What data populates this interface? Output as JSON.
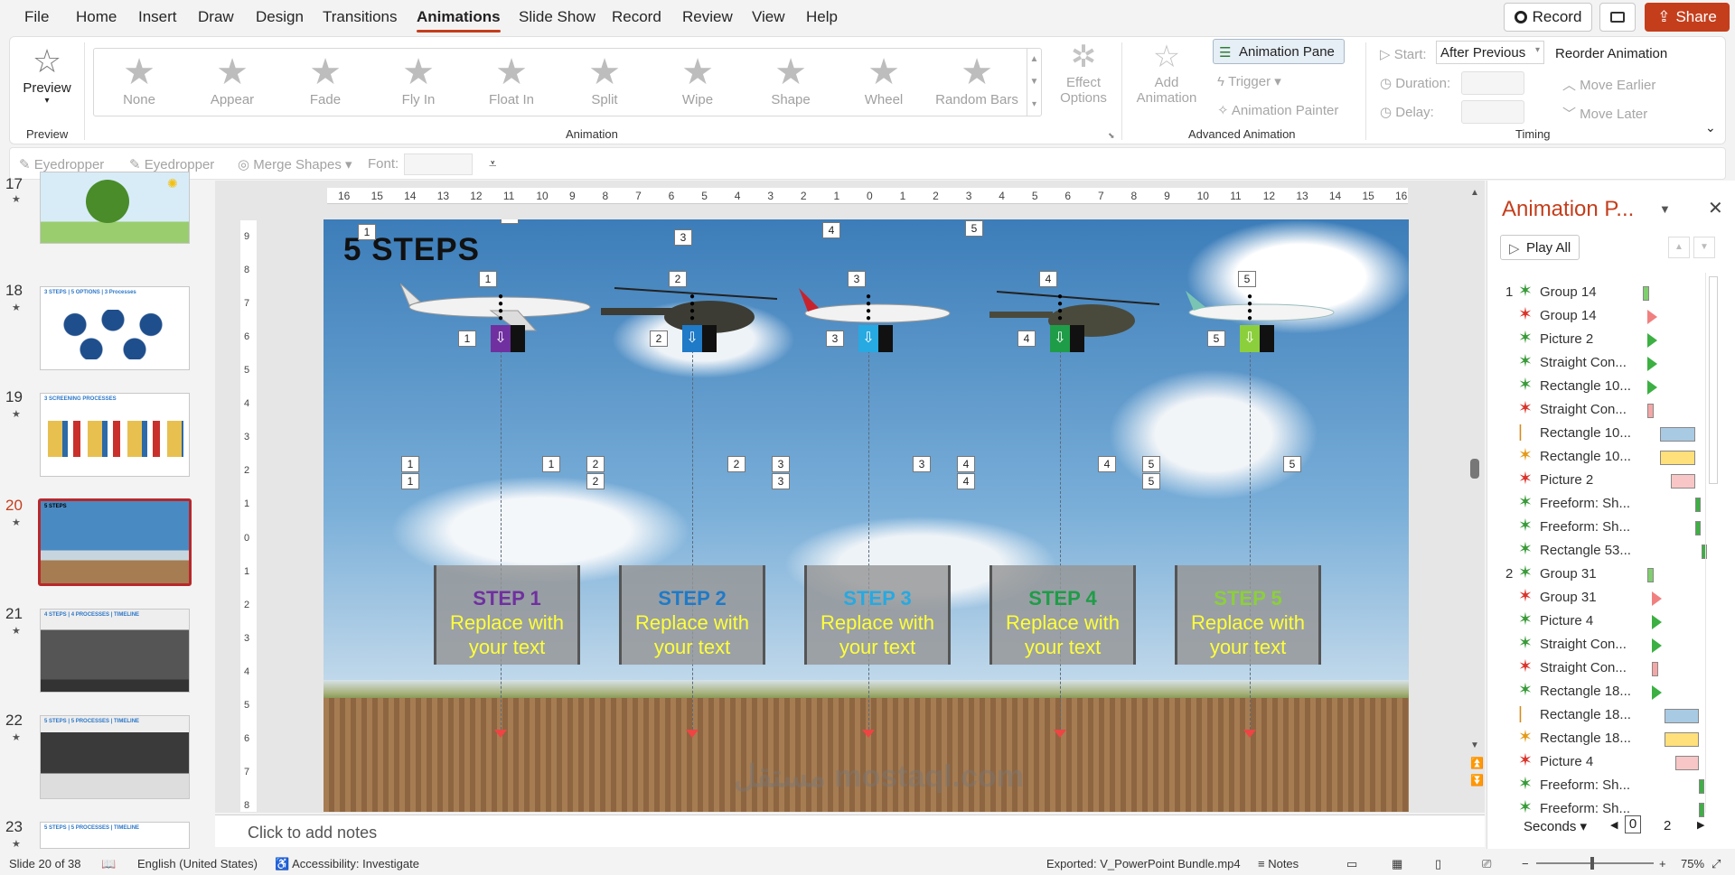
{
  "menu": {
    "items": [
      "File",
      "Home",
      "Insert",
      "Draw",
      "Design",
      "Transitions",
      "Animations",
      "Slide Show",
      "Record",
      "Review",
      "View",
      "Help"
    ],
    "active": "Animations",
    "record_label": "Record",
    "share_label": "Share"
  },
  "ribbon": {
    "preview_label": "Preview",
    "preview_group": "Preview",
    "animations": [
      "None",
      "Appear",
      "Fade",
      "Fly In",
      "Float In",
      "Split",
      "Wipe",
      "Shape",
      "Wheel",
      "Random Bars"
    ],
    "effect_options": "Effect Options",
    "animation_group": "Animation",
    "add_animation": "Add Animation",
    "animation_pane": "Animation Pane",
    "trigger": "Trigger",
    "animation_painter": "Animation Painter",
    "advanced_group": "Advanced Animation",
    "start_label": "Start:",
    "start_value": "After Previous",
    "duration_label": "Duration:",
    "delay_label": "Delay:",
    "timing_group": "Timing",
    "reorder_title": "Reorder Animation",
    "move_earlier": "Move Earlier",
    "move_later": "Move Later"
  },
  "qat": {
    "eyedropper1": "Eyedropper",
    "eyedropper2": "Eyedropper",
    "merge_shapes": "Merge Shapes",
    "font_label": "Font:"
  },
  "thumbnails": [
    {
      "num": "17",
      "title": ""
    },
    {
      "num": "18",
      "title": "3 STEPS | 5 OPTIONS | 3 Processes"
    },
    {
      "num": "19",
      "title": "3 SCREENING PROCESSES"
    },
    {
      "num": "20",
      "title": "5 STEPS"
    },
    {
      "num": "21",
      "title": "4 STEPS | 4 PROCESSES | TIMELINE"
    },
    {
      "num": "22",
      "title": "5 STEPS | 5 PROCESSES | TIMELINE"
    },
    {
      "num": "23",
      "title": "5 STEPS | 5 PROCESSES | TIMELINE"
    }
  ],
  "slide": {
    "title": "5 STEPS",
    "steps": [
      {
        "label": "STEP 1",
        "text1": "Replace with",
        "text2": "your text",
        "color": "#7030a0",
        "marker": "#7030a0"
      },
      {
        "label": "STEP 2",
        "text1": "Replace with",
        "text2": "your text",
        "color": "#1f7ac7",
        "marker": "#1f7ac7"
      },
      {
        "label": "STEP 3",
        "text1": "Replace with",
        "text2": "your text",
        "color": "#27a9e1",
        "marker": "#27a9e1"
      },
      {
        "label": "STEP 4",
        "text1": "Replace with",
        "text2": "your text",
        "color": "#1f9c47",
        "marker": "#1f9c47"
      },
      {
        "label": "STEP 5",
        "text1": "Replace with",
        "text2": "your text",
        "color": "#8ccf3c",
        "marker": "#8ccf3c"
      }
    ],
    "tags": [
      "1",
      "2",
      "3",
      "4",
      "5"
    ]
  },
  "ruler": {
    "h_ticks": [
      "16",
      "15",
      "14",
      "13",
      "12",
      "11",
      "10",
      "9",
      "8",
      "7",
      "6",
      "5",
      "4",
      "3",
      "2",
      "1",
      "0",
      "1",
      "2",
      "3",
      "4",
      "5",
      "6",
      "7",
      "8",
      "9",
      "10",
      "11",
      "12",
      "13",
      "14",
      "15",
      "16"
    ],
    "v_ticks": [
      "9",
      "8",
      "7",
      "6",
      "5",
      "4",
      "3",
      "2",
      "1",
      "0",
      "1",
      "2",
      "3",
      "4",
      "5",
      "6",
      "7",
      "8"
    ]
  },
  "notes": {
    "placeholder": "Click to add notes"
  },
  "pane": {
    "title": "Animation P...",
    "play_all": "Play All",
    "items": [
      {
        "num": "1",
        "label": "Group 14",
        "icon": "zoom",
        "color": "#3a9a3a",
        "bar": "#7fcf6e",
        "bar_type": "rect",
        "bar_pos": 0.55,
        "bar_w": 0.03
      },
      {
        "num": "",
        "label": "Group 14",
        "icon": "star",
        "color": "#d9342b",
        "bar": "#f08080",
        "bar_type": "tri",
        "bar_pos": 0.57,
        "bar_w": 0.03
      },
      {
        "num": "",
        "label": "Picture 2",
        "icon": "star",
        "color": "#3a9a3a",
        "bar": "#3cb043",
        "bar_type": "tri",
        "bar_pos": 0.57,
        "bar_w": 0.03
      },
      {
        "num": "",
        "label": "Straight Con...",
        "icon": "star",
        "color": "#3a9a3a",
        "bar": "#3cb043",
        "bar_type": "tri",
        "bar_pos": 0.57,
        "bar_w": 0.03
      },
      {
        "num": "",
        "label": "Rectangle 10...",
        "icon": "star",
        "color": "#3a9a3a",
        "bar": "#3cb043",
        "bar_type": "tri",
        "bar_pos": 0.57,
        "bar_w": 0.03
      },
      {
        "num": "",
        "label": "Straight Con...",
        "icon": "star",
        "color": "#d9342b",
        "bar": "#f5a6a6",
        "bar_type": "rect",
        "bar_pos": 0.57,
        "bar_w": 0.03
      },
      {
        "num": "",
        "label": "Rectangle 10...",
        "icon": "line",
        "color": "#d48a1a",
        "bar": "#a8cae3",
        "bar_type": "rect",
        "bar_pos": 0.63,
        "bar_w": 0.16
      },
      {
        "num": "",
        "label": "Rectangle 10...",
        "icon": "star",
        "color": "#e39a1a",
        "bar": "#ffe07a",
        "bar_type": "rect",
        "bar_pos": 0.63,
        "bar_w": 0.16
      },
      {
        "num": "",
        "label": "Picture 2",
        "icon": "star",
        "color": "#d9342b",
        "bar": "#f8c6c6",
        "bar_type": "rect",
        "bar_pos": 0.68,
        "bar_w": 0.11
      },
      {
        "num": "",
        "label": "Freeform: Sh...",
        "icon": "star",
        "color": "#3a9a3a",
        "bar": "#3cb043",
        "bar_type": "rect",
        "bar_pos": 0.79,
        "bar_w": 0.01
      },
      {
        "num": "",
        "label": "Freeform: Sh...",
        "icon": "star",
        "color": "#3a9a3a",
        "bar": "#3cb043",
        "bar_type": "rect",
        "bar_pos": 0.79,
        "bar_w": 0.01
      },
      {
        "num": "",
        "label": "Rectangle 53...",
        "icon": "star",
        "color": "#3a9a3a",
        "bar": "#3cb043",
        "bar_type": "rect",
        "bar_pos": 0.82,
        "bar_w": 0.01
      },
      {
        "num": "2",
        "label": "Group 31",
        "icon": "zoom",
        "color": "#3a9a3a",
        "bar": "#7fcf6e",
        "bar_type": "rect",
        "bar_pos": 0.57,
        "bar_w": 0.03
      },
      {
        "num": "",
        "label": "Group 31",
        "icon": "star",
        "color": "#d9342b",
        "bar": "#f08080",
        "bar_type": "tri",
        "bar_pos": 0.59,
        "bar_w": 0.03
      },
      {
        "num": "",
        "label": "Picture 4",
        "icon": "star",
        "color": "#3a9a3a",
        "bar": "#3cb043",
        "bar_type": "tri",
        "bar_pos": 0.59,
        "bar_w": 0.03
      },
      {
        "num": "",
        "label": "Straight Con...",
        "icon": "star",
        "color": "#3a9a3a",
        "bar": "#3cb043",
        "bar_type": "tri",
        "bar_pos": 0.59,
        "bar_w": 0.03
      },
      {
        "num": "",
        "label": "Straight Con...",
        "icon": "star",
        "color": "#d9342b",
        "bar": "#f5a6a6",
        "bar_type": "rect",
        "bar_pos": 0.59,
        "bar_w": 0.03
      },
      {
        "num": "",
        "label": "Rectangle 18...",
        "icon": "star",
        "color": "#3a9a3a",
        "bar": "#3cb043",
        "bar_type": "tri",
        "bar_pos": 0.59,
        "bar_w": 0.03
      },
      {
        "num": "",
        "label": "Rectangle 18...",
        "icon": "line",
        "color": "#d48a1a",
        "bar": "#a8cae3",
        "bar_type": "rect",
        "bar_pos": 0.65,
        "bar_w": 0.16
      },
      {
        "num": "",
        "label": "Rectangle 18...",
        "icon": "star",
        "color": "#e39a1a",
        "bar": "#ffe07a",
        "bar_type": "rect",
        "bar_pos": 0.65,
        "bar_w": 0.16
      },
      {
        "num": "",
        "label": "Picture 4",
        "icon": "star",
        "color": "#d9342b",
        "bar": "#f8c6c6",
        "bar_type": "rect",
        "bar_pos": 0.7,
        "bar_w": 0.11
      },
      {
        "num": "",
        "label": "Freeform: Sh...",
        "icon": "star",
        "color": "#3a9a3a",
        "bar": "#3cb043",
        "bar_type": "rect",
        "bar_pos": 0.81,
        "bar_w": 0.01
      },
      {
        "num": "",
        "label": "Freeform: Sh...",
        "icon": "star",
        "color": "#3a9a3a",
        "bar": "#3cb043",
        "bar_type": "rect",
        "bar_pos": 0.81,
        "bar_w": 0.01
      }
    ],
    "seconds_label": "Seconds",
    "timeline_start": "0",
    "timeline_end": "2"
  },
  "status": {
    "slide_info": "Slide 20 of 38",
    "language": "English (United States)",
    "accessibility": "Accessibility: Investigate",
    "exported": "Exported: V_PowerPoint Bundle.mp4",
    "notes": "Notes",
    "zoom": "75%"
  },
  "watermark": "مستقل mostaql.com",
  "colors": {
    "accent": "#c43e1c",
    "brand_red": "#c43e1c"
  }
}
